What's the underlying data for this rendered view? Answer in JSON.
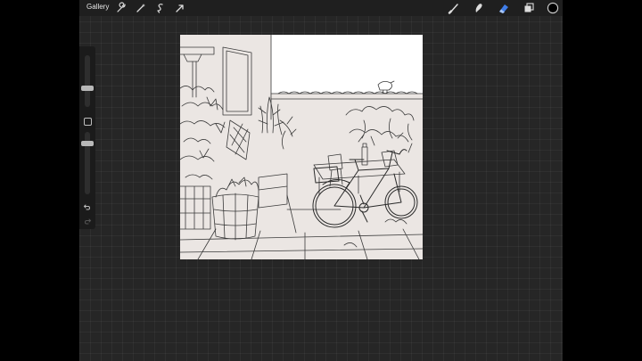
{
  "toolbar": {
    "gallery_label": "Gallery",
    "left_tools": [
      "wrench-icon",
      "magic-wand-icon",
      "selection-icon",
      "transform-arrow-icon"
    ],
    "right_tools": [
      "brush-icon",
      "smudge-icon",
      "eraser-icon",
      "layers-icon",
      "color-swatch"
    ],
    "active_tool": "eraser-icon",
    "accent_color": "#3f7de8",
    "current_color": "#000000"
  },
  "sidebar": {
    "brush_size": 0.45,
    "brush_opacity": 0.15
  },
  "canvas": {
    "paper_color": "#ebe6e3",
    "sky_color": "#ffffff",
    "subject": "courtyard-bicycle-line-art"
  }
}
